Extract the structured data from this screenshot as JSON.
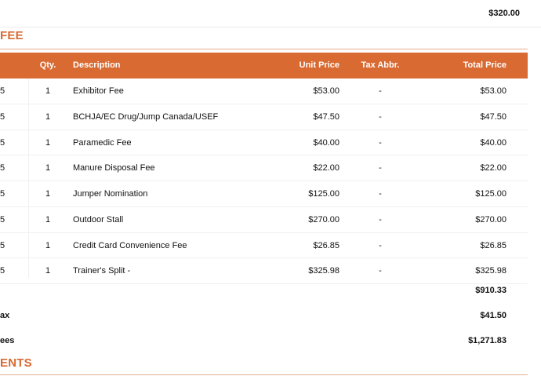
{
  "previous_total": "$320.00",
  "section_fee_title": "FEE",
  "section_payments_title": "ENTS",
  "table": {
    "headers": {
      "qty": "Qty.",
      "description": "Description",
      "unit_price": "Unit Price",
      "tax_abbr": "Tax Abbr.",
      "total_price": "Total Price"
    },
    "rows": [
      {
        "date": "5",
        "qty": "1",
        "description": "Exhibitor Fee",
        "unit_price": "$53.00",
        "tax": "-",
        "total": "$53.00"
      },
      {
        "date": "5",
        "qty": "1",
        "description": "BCHJA/EC Drug/Jump Canada/USEF",
        "unit_price": "$47.50",
        "tax": "-",
        "total": "$47.50"
      },
      {
        "date": "5",
        "qty": "1",
        "description": "Paramedic Fee",
        "unit_price": "$40.00",
        "tax": "-",
        "total": "$40.00"
      },
      {
        "date": "5",
        "qty": "1",
        "description": "Manure Disposal Fee",
        "unit_price": "$22.00",
        "tax": "-",
        "total": "$22.00"
      },
      {
        "date": "5",
        "qty": "1",
        "description": "Jumper Nomination",
        "unit_price": "$125.00",
        "tax": "-",
        "total": "$125.00"
      },
      {
        "date": "5",
        "qty": "1",
        "description": "Outdoor Stall",
        "unit_price": "$270.00",
        "tax": "-",
        "total": "$270.00"
      },
      {
        "date": "5",
        "qty": "1",
        "description": "Credit Card Convenience Fee",
        "unit_price": "$26.85",
        "tax": "-",
        "total": "$26.85"
      },
      {
        "date": "5",
        "qty": "1",
        "description": "Trainer's Split -",
        "unit_price": "$325.98",
        "tax": "-",
        "total": "$325.98"
      }
    ]
  },
  "summary": {
    "subtotal_label": "",
    "subtotal_value": "$910.33",
    "tax_label": "ax",
    "tax_value": "$41.50",
    "total_label": "ees",
    "total_value": "$1,271.83"
  }
}
